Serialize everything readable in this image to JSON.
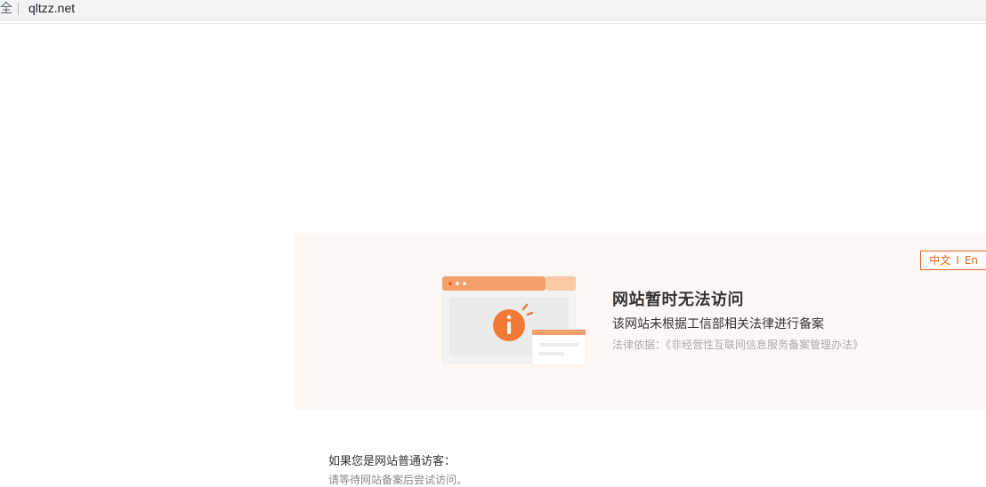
{
  "address_bar": {
    "secure_label": "全",
    "url": "qltzz.net"
  },
  "notice": {
    "lang_zh": "中文",
    "lang_sep": "I",
    "lang_en": "En",
    "title": "网站暂时无法访问",
    "description": "该网站未根据工信部相关法律进行备案",
    "law_basis": "法律依据：《非经营性互联网信息服务备案管理办法》",
    "illustration_icon": "info-icon"
  },
  "visitor": {
    "heading": "如果您是网站普通访客：",
    "text": "请等待网站备案后尝试访问。"
  },
  "colors": {
    "accent": "#e8641b",
    "panel_bg": "#fef8f5"
  }
}
